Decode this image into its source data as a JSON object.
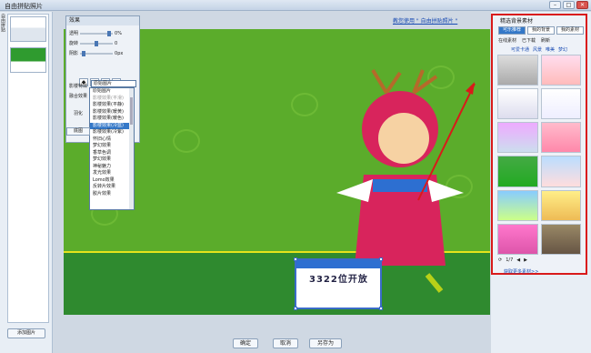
{
  "window": {
    "title": "自由拼贴照片"
  },
  "left": {
    "tab_label": "自由拼贴",
    "add_label": "添加图片"
  },
  "help_link": "教您使用 \" 自由拼贴照片 \"",
  "effects": {
    "title": "效果",
    "sliders": [
      {
        "label": "透明",
        "value": "0%"
      },
      {
        "label": "旋转",
        "value": "0"
      },
      {
        "label": "阴影",
        "value": "0px"
      }
    ],
    "effect_label": "影楼特效",
    "effect_value": "原始图片",
    "blend_label": "融合效果",
    "blend_small": "羽化",
    "options": [
      "原始图片",
      "影楼效果(平滑)",
      "影楼效果(平静)",
      "影楼效果(暖黄)",
      "影楼效果(暖色)",
      "影楼效果(冷蓝)",
      "影楼效果(冷紫)",
      "怀旧心情",
      "梦幻效果",
      "香草色调",
      "梦幻效果",
      "神秘魅力",
      "发光效果",
      "Lomo效果",
      "反转片效果",
      "胶片效果"
    ],
    "selected_index": 5,
    "cancel_label": "底图"
  },
  "canvas": {
    "shot_text": "3322位开放"
  },
  "bottom": {
    "ok": "确定",
    "cancel": "取消",
    "saveas": "另存为"
  },
  "right": {
    "title": "精选背景素材",
    "tabs": [
      "可乐推荐",
      "我的背景",
      "我的素材"
    ],
    "radios": [
      "在线素材",
      "已下载",
      "刷新"
    ],
    "categories": [
      "可爱卡通",
      "风景",
      "唯美",
      "梦幻"
    ],
    "page": "1/7",
    "more": "获取更多素材>>"
  }
}
